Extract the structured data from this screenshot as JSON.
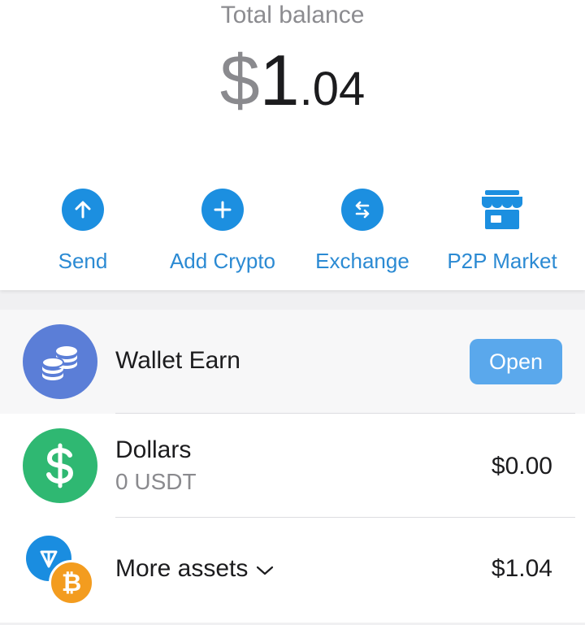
{
  "balance": {
    "label": "Total balance",
    "currency_symbol": "$",
    "whole": "1",
    "fraction": ".04"
  },
  "actions": [
    {
      "label": "Send",
      "icon": "arrow-up-icon"
    },
    {
      "label": "Add Crypto",
      "icon": "plus-icon"
    },
    {
      "label": "Exchange",
      "icon": "exchange-icon"
    },
    {
      "label": "P2P Market",
      "icon": "shop-icon"
    }
  ],
  "earn": {
    "title": "Wallet Earn",
    "button_label": "Open",
    "icon": "coins-icon"
  },
  "dollars": {
    "title": "Dollars",
    "subtitle": "0 USDT",
    "value": "$0.00",
    "icon": "dollar-icon"
  },
  "more_assets": {
    "title": "More assets",
    "value": "$1.04",
    "icons": [
      "ton-icon",
      "bitcoin-icon"
    ],
    "bitcoin_glyph": "₿"
  },
  "colors": {
    "accent": "#1c8fe0",
    "earn_icon_bg": "#5b7ed7",
    "dollar_icon_bg": "#2fb872",
    "bitcoin_bg": "#f39c1f",
    "open_button_bg": "#5aa8ec"
  }
}
